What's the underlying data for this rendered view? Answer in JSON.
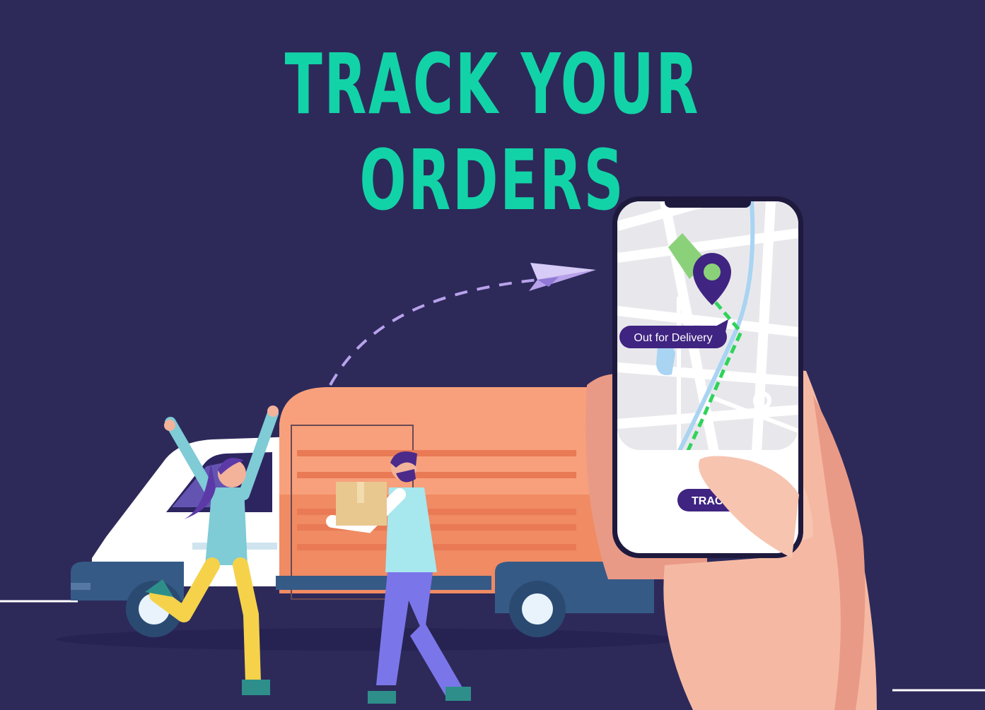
{
  "headline": "TRACK YOUR ORDERS",
  "phone": {
    "status_label": "Out for Delivery",
    "track_button_label": "TRACK"
  },
  "colors": {
    "background": "#2d2a5a",
    "headline": "#12d3a7",
    "accent_purple": "#4b2a8a",
    "truck_orange": "#f4956c",
    "route_green": "#2fd35a"
  }
}
